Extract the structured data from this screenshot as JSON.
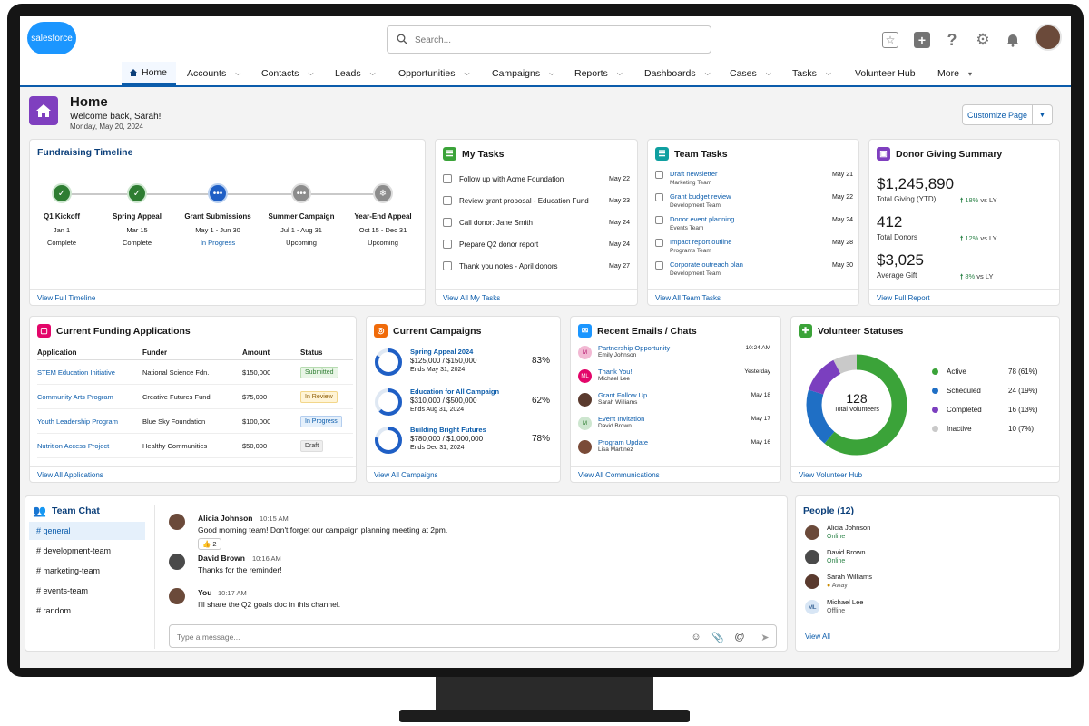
{
  "app": {
    "logo_text": "salesforce",
    "accent": "#0b5cab"
  },
  "search": {
    "placeholder": "Search..."
  },
  "topbar_icons": [
    "favorites-star-icon",
    "add-plus-icon",
    "help-question-icon",
    "settings-gear-icon",
    "notifications-bell-icon"
  ],
  "nav": {
    "home": "Home",
    "items": [
      "Accounts",
      "Contacts",
      "Leads",
      "Opportunities",
      "Campaigns",
      "Reports",
      "Dashboards",
      "Cases",
      "Tasks",
      "Volunteer Hub",
      "More"
    ]
  },
  "page": {
    "title": "Home",
    "welcome": "Welcome back, Sarah!",
    "date": "Monday, May 20, 2024",
    "customize_label": "Customize Page"
  },
  "timeline": {
    "title": "Fundraising Timeline",
    "footer": "View Full Timeline",
    "milestones": [
      {
        "name": "Q1 Kickoff",
        "dates": "Jan 1",
        "status": "Complete"
      },
      {
        "name": "Spring Appeal",
        "dates": "Mar 15",
        "status": "Complete"
      },
      {
        "name": "Grant Submissions",
        "dates": "May 1 - Jun 30",
        "status": "In Progress"
      },
      {
        "name": "Summer Campaign",
        "dates": "Jul 1 - Aug 31",
        "status": "Upcoming"
      },
      {
        "name": "Year-End Appeal",
        "dates": "Oct 15 - Dec 31",
        "status": "Upcoming"
      }
    ]
  },
  "my_tasks": {
    "title": "My Tasks",
    "footer": "View All My Tasks",
    "items": [
      {
        "label": "Follow up with Acme Foundation",
        "date": "May 22"
      },
      {
        "label": "Review grant proposal - Education Fund",
        "date": "May 23"
      },
      {
        "label": "Call donor: Jane Smith",
        "date": "May 24"
      },
      {
        "label": "Prepare Q2 donor report",
        "date": "May 24"
      },
      {
        "label": "Thank you notes - April donors",
        "date": "May 27"
      }
    ]
  },
  "team_tasks": {
    "title": "Team Tasks",
    "footer": "View All Team Tasks",
    "items": [
      {
        "label": "Draft newsletter",
        "team": "Marketing Team",
        "date": "May 21"
      },
      {
        "label": "Grant budget review",
        "team": "Development Team",
        "date": "May 22"
      },
      {
        "label": "Donor event planning",
        "team": "Events Team",
        "date": "May 24"
      },
      {
        "label": "Impact report outline",
        "team": "Programs Team",
        "date": "May 28"
      },
      {
        "label": "Corporate outreach plan",
        "team": "Development Team",
        "date": "May 30"
      }
    ]
  },
  "donor_summary": {
    "title": "Donor Giving Summary",
    "footer": "View Full Report",
    "metrics": [
      {
        "value": "$1,245,890",
        "label": "Total Giving (YTD)",
        "trend": "18%",
        "vs": "vs LY"
      },
      {
        "value": "412",
        "label": "Total Donors",
        "trend": "12%",
        "vs": "vs LY"
      },
      {
        "value": "$3,025",
        "label": "Average Gift",
        "trend": "8%",
        "vs": "vs LY"
      }
    ]
  },
  "funding": {
    "title": "Current Funding Applications",
    "footer": "View All Applications",
    "headers": [
      "Application",
      "Funder",
      "Amount",
      "Status"
    ],
    "rows": [
      {
        "application": "STEM Education Initiative",
        "funder": "National Science Fdn.",
        "amount": "$150,000",
        "status": "Submitted"
      },
      {
        "application": "Community Arts Program",
        "funder": "Creative Futures Fund",
        "amount": "$75,000",
        "status": "In Review"
      },
      {
        "application": "Youth Leadership Program",
        "funder": "Blue Sky Foundation",
        "amount": "$100,000",
        "status": "In Progress"
      },
      {
        "application": "Nutrition Access Project",
        "funder": "Healthy Communities",
        "amount": "$50,000",
        "status": "Draft"
      }
    ]
  },
  "campaigns": {
    "title": "Current Campaigns",
    "footer": "View All Campaigns",
    "items": [
      {
        "name": "Spring Appeal 2024",
        "amounts": "$125,000 / $150,000",
        "ends": "Ends May 31, 2024",
        "percent": "83%",
        "progress": 0.83
      },
      {
        "name": "Education for All Campaign",
        "amounts": "$310,000 / $500,000",
        "ends": "Ends Aug 31, 2024",
        "percent": "62%",
        "progress": 0.62
      },
      {
        "name": "Building Bright Futures",
        "amounts": "$780,000 / $1,000,000",
        "ends": "Ends Dec 31, 2024",
        "percent": "78%",
        "progress": 0.78
      }
    ]
  },
  "emails": {
    "title": "Recent Emails / Chats",
    "footer": "View All Communications",
    "items": [
      {
        "subject": "Partnership Opportunity",
        "from": "Emily Johnson",
        "date": "10:24 AM"
      },
      {
        "subject": "Thank You!",
        "from": "Michael Lee",
        "date": "Yesterday"
      },
      {
        "subject": "Grant Follow Up",
        "from": "Sarah Williams",
        "date": "May 18"
      },
      {
        "subject": "Event Invitation",
        "from": "David Brown",
        "date": "May 17"
      },
      {
        "subject": "Program Update",
        "from": "Lisa Martinez",
        "date": "May 16"
      }
    ]
  },
  "volunteers": {
    "title": "Volunteer Statuses",
    "footer": "View Volunteer Hub",
    "total": "128",
    "total_label": "Total Volunteers",
    "segments": [
      {
        "label": "Active",
        "value": "78 (61%)",
        "count": 78,
        "color": "#3ba339"
      },
      {
        "label": "Scheduled",
        "value": "24 (19%)",
        "count": 24,
        "color": "#1f6fc5"
      },
      {
        "label": "Completed",
        "value": "16 (13%)",
        "count": 16,
        "color": "#7b3fbf"
      },
      {
        "label": "Inactive",
        "value": "10 (7%)",
        "count": 10,
        "color": "#c9c9c9"
      }
    ]
  },
  "team_chat": {
    "title": "Team Chat",
    "channels": [
      "general",
      "development-team",
      "marketing-team",
      "events-team",
      "random"
    ],
    "messages": [
      {
        "name": "Alicia Johnson",
        "time": "10:15 AM",
        "text": "Good morning team! Don't forget our campaign planning meeting at 2pm.",
        "reaction": "👍 2"
      },
      {
        "name": "David Brown",
        "time": "10:16 AM",
        "text": "Thanks for the reminder!"
      },
      {
        "name": "You",
        "time": "10:17 AM",
        "text": "I'll share the Q2 goals doc in this channel."
      }
    ],
    "composer_placeholder": "Type a message..."
  },
  "people": {
    "title": "People (12)",
    "footer": "View All",
    "items": [
      {
        "name": "Alicia Johnson",
        "status": "Online"
      },
      {
        "name": "David Brown",
        "status": "Online"
      },
      {
        "name": "Sarah Williams",
        "status": "Away"
      },
      {
        "name": "Michael Lee",
        "status": "Offline",
        "initials": "ML"
      }
    ]
  }
}
